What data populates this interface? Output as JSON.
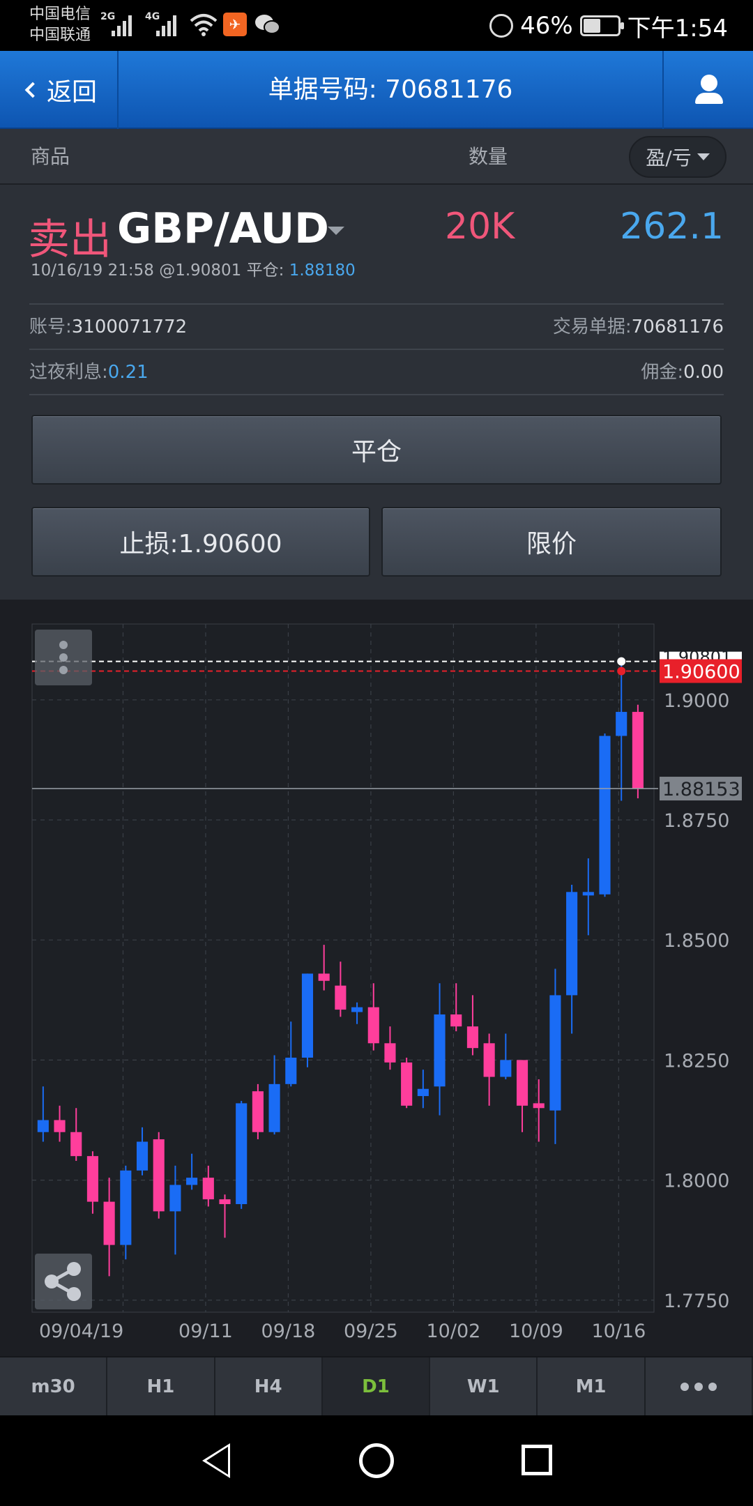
{
  "status_bar": {
    "carrier_1": "中国电信",
    "carrier_2": "中国联通",
    "net_1": "2G",
    "net_2": "4G",
    "battery": "46%",
    "time": "下午1:54"
  },
  "header": {
    "back_label": "返回",
    "title": "单据号码: 70681176"
  },
  "columns": {
    "product": "商品",
    "quantity": "数量",
    "pl_toggle": "盈/亏"
  },
  "trade": {
    "side": "卖出",
    "symbol": "GBP/AUD",
    "quantity": "20K",
    "profit": "262.1",
    "open_info": "10/16/19 21:58 @1.90801 平仓: ",
    "close_price": "1.88180",
    "account_label": "账号:",
    "account_value": "3100071772",
    "ticket_label": "交易单据:",
    "ticket_value": "70681176",
    "swap_label": "过夜利息:",
    "swap_value": "0.21",
    "commission_label": "佣金:",
    "commission_value": "0.00"
  },
  "buttons": {
    "close_position": "平仓",
    "stop_loss": "止损:1.90600",
    "limit": "限价"
  },
  "chart_data": {
    "type": "candlestick",
    "x_labels": [
      "09/04/19",
      "09/11",
      "09/18",
      "09/25",
      "10/02",
      "10/09",
      "10/16"
    ],
    "y_ticks": [
      "1.7750",
      "1.8000",
      "1.8250",
      "1.8500",
      "1.8750",
      "1.9000"
    ],
    "y_range": [
      1.7725,
      1.9158
    ],
    "current_price": "1.88153",
    "stop_loss_price": "1.90600",
    "open_price_label": "1.90801",
    "colors": {
      "up": "#1a6cf5",
      "down": "#ff3e9c",
      "stop_line": "#e8202a",
      "open_line": "#ffffff"
    },
    "candles": [
      {
        "o": 1.81,
        "h": 1.8195,
        "l": 1.808,
        "c": 1.8125
      },
      {
        "o": 1.8125,
        "h": 1.8155,
        "l": 1.808,
        "c": 1.81
      },
      {
        "o": 1.81,
        "h": 1.815,
        "l": 1.804,
        "c": 1.805
      },
      {
        "o": 1.805,
        "h": 1.806,
        "l": 1.793,
        "c": 1.7955
      },
      {
        "o": 1.7955,
        "h": 1.8005,
        "l": 1.78,
        "c": 1.7865
      },
      {
        "o": 1.7865,
        "h": 1.803,
        "l": 1.7835,
        "c": 1.802
      },
      {
        "o": 1.802,
        "h": 1.811,
        "l": 1.801,
        "c": 1.808
      },
      {
        "o": 1.8085,
        "h": 1.81,
        "l": 1.792,
        "c": 1.7935
      },
      {
        "o": 1.7935,
        "h": 1.803,
        "l": 1.7845,
        "c": 1.799
      },
      {
        "o": 1.799,
        "h": 1.8055,
        "l": 1.798,
        "c": 1.8005
      },
      {
        "o": 1.8005,
        "h": 1.803,
        "l": 1.7945,
        "c": 1.796
      },
      {
        "o": 1.796,
        "h": 1.797,
        "l": 1.788,
        "c": 1.795
      },
      {
        "o": 1.795,
        "h": 1.8165,
        "l": 1.794,
        "c": 1.816
      },
      {
        "o": 1.8185,
        "h": 1.82,
        "l": 1.8085,
        "c": 1.81
      },
      {
        "o": 1.81,
        "h": 1.826,
        "l": 1.8095,
        "c": 1.82
      },
      {
        "o": 1.82,
        "h": 1.833,
        "l": 1.8195,
        "c": 1.8255
      },
      {
        "o": 1.8255,
        "h": 1.843,
        "l": 1.8235,
        "c": 1.843
      },
      {
        "o": 1.843,
        "h": 1.849,
        "l": 1.8395,
        "c": 1.8415
      },
      {
        "o": 1.8405,
        "h": 1.8455,
        "l": 1.834,
        "c": 1.8355
      },
      {
        "o": 1.835,
        "h": 1.837,
        "l": 1.8325,
        "c": 1.836
      },
      {
        "o": 1.836,
        "h": 1.841,
        "l": 1.827,
        "c": 1.8285
      },
      {
        "o": 1.8285,
        "h": 1.832,
        "l": 1.823,
        "c": 1.8245
      },
      {
        "o": 1.8245,
        "h": 1.8255,
        "l": 1.815,
        "c": 1.8155
      },
      {
        "o": 1.8175,
        "h": 1.823,
        "l": 1.815,
        "c": 1.819
      },
      {
        "o": 1.8195,
        "h": 1.841,
        "l": 1.8135,
        "c": 1.8345
      },
      {
        "o": 1.8345,
        "h": 1.841,
        "l": 1.831,
        "c": 1.832
      },
      {
        "o": 1.832,
        "h": 1.8385,
        "l": 1.826,
        "c": 1.8275
      },
      {
        "o": 1.8285,
        "h": 1.8305,
        "l": 1.8155,
        "c": 1.8215
      },
      {
        "o": 1.8215,
        "h": 1.8305,
        "l": 1.821,
        "c": 1.825
      },
      {
        "o": 1.825,
        "h": 1.825,
        "l": 1.81,
        "c": 1.8155
      },
      {
        "o": 1.816,
        "h": 1.821,
        "l": 1.808,
        "c": 1.815
      },
      {
        "o": 1.8145,
        "h": 1.844,
        "l": 1.8075,
        "c": 1.8385
      },
      {
        "o": 1.8385,
        "h": 1.8615,
        "l": 1.8305,
        "c": 1.86
      },
      {
        "o": 1.8595,
        "h": 1.867,
        "l": 1.851,
        "c": 1.86
      },
      {
        "o": 1.8595,
        "h": 1.893,
        "l": 1.859,
        "c": 1.8925
      },
      {
        "o": 1.8925,
        "h": 1.908,
        "l": 1.879,
        "c": 1.8975
      },
      {
        "o": 1.8975,
        "h": 1.899,
        "l": 1.8795,
        "c": 1.8815
      }
    ]
  },
  "timeframes": {
    "m30": "m30",
    "h1": "H1",
    "h4": "H4",
    "d1": "D1",
    "w1": "W1",
    "mn1": "M1"
  }
}
